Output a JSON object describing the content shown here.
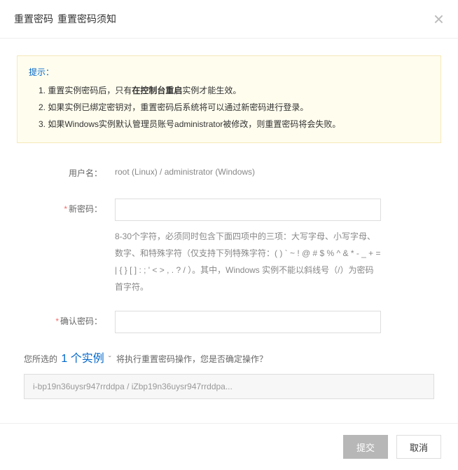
{
  "header": {
    "title_main": "重置密码",
    "title_sub": "重置密码须知"
  },
  "notice": {
    "title": "提示：",
    "items": [
      {
        "prefix": "1. 重置实例密码后，只有",
        "bold": "在控制台重启",
        "suffix": "实例才能生效。"
      },
      {
        "prefix": "2. 如果实例已绑定密钥对，重置密码后系统将可以通过新密码进行登录。",
        "bold": "",
        "suffix": ""
      },
      {
        "prefix": "3. 如果Windows实例默认管理员账号administrator被修改，则重置密码将会失败。",
        "bold": "",
        "suffix": ""
      }
    ]
  },
  "form": {
    "username_label": "用户名：",
    "username_value": "root (Linux) / administrator (Windows)",
    "newpwd_label": "新密码：",
    "newpwd_value": "",
    "newpwd_hint": "8-30个字符，必须同时包含下面四项中的三项：大写字母、小写字母、数字、和特殊字符（仅支持下列特殊字符：( ) ` ~ ! @ # $ % ^ & * - _ + = | { } [ ] : ; ' < > , . ? / ）。其中，Windows 实例不能以斜线号（/）为密码首字符。",
    "confirmpwd_label": "确认密码：",
    "confirmpwd_value": ""
  },
  "summary": {
    "prefix": "您所选的 ",
    "count": "1 个实例",
    "caret": "ˇ",
    "suffix": " 将执行重置密码操作，您是否确定操作？",
    "instance": "i-bp19n36uysr947rrddpa / iZbp19n36uysr947rrddpa..."
  },
  "footer": {
    "submit": "提交",
    "cancel": "取消"
  }
}
